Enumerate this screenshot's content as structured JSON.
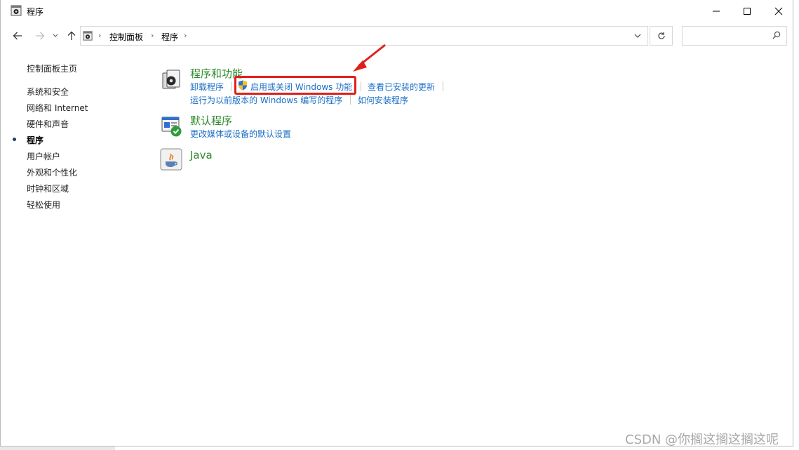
{
  "window": {
    "title": "程序"
  },
  "nav": {
    "breadcrumbs": [
      "控制面板",
      "程序"
    ],
    "search_placeholder": ""
  },
  "sidebar": {
    "home": "控制面板主页",
    "items": [
      {
        "label": "系统和安全",
        "active": false
      },
      {
        "label": "网络和 Internet",
        "active": false
      },
      {
        "label": "硬件和声音",
        "active": false
      },
      {
        "label": "程序",
        "active": true
      },
      {
        "label": "用户帐户",
        "active": false
      },
      {
        "label": "外观和个性化",
        "active": false
      },
      {
        "label": "时钟和区域",
        "active": false
      },
      {
        "label": "轻松使用",
        "active": false
      }
    ]
  },
  "categories": {
    "programs": {
      "title": "程序和功能",
      "links": [
        "卸载程序",
        "启用或关闭 Windows 功能",
        "查看已安装的更新",
        "运行为以前版本的 Windows 编写的程序",
        "如何安装程序"
      ]
    },
    "defaults": {
      "title": "默认程序",
      "links": [
        "更改媒体或设备的默认设置"
      ]
    },
    "java": {
      "title": "Java"
    }
  },
  "watermark": "CSDN @你搁这搁这搁这呢",
  "colors": {
    "link": "#1a6fc6",
    "category_title": "#2b8a2b",
    "highlight": "#e0201b"
  }
}
